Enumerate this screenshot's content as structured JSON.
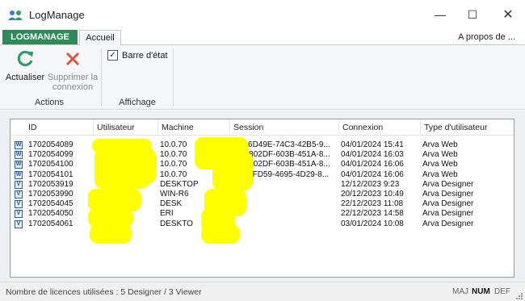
{
  "window": {
    "title": "LogManage",
    "minimize_glyph": "—",
    "maximize_glyph": "☐",
    "close_glyph": "✕",
    "icon": "users-icon"
  },
  "ribbon_tabs": {
    "app_tab": "LOGMANAGE",
    "home_tab": "Accueil",
    "about": "A propos de ..."
  },
  "ribbon": {
    "actions": {
      "label": "Actions",
      "refresh_label": "Actualiser",
      "delete_label_line1": "Supprimer la",
      "delete_label_line2": "connexion",
      "refresh_icon": "refresh-icon",
      "delete_icon": "delete-x-icon"
    },
    "display": {
      "label": "Affichage",
      "statusbar_checkbox": "Barre d'état",
      "statusbar_checked": true
    }
  },
  "table": {
    "columns": [
      "ID",
      "Utilisateur",
      "Machine",
      "Session",
      "Connexion",
      "Type d'utilisateur"
    ],
    "rows": [
      {
        "id": "1702054089",
        "user": "",
        "machine": "10.0.70",
        "session": "{7886D49E-74C3-42B5-9...",
        "connexion": "04/01/2024 15:41",
        "type": "Arva Web",
        "icon": "W"
      },
      {
        "id": "1702054099",
        "user": "",
        "machine": "10.0.70",
        "session": "{B91802DF-603B-451A-8...",
        "connexion": "04/01/2024 16:03",
        "type": "Arva Web",
        "icon": "W"
      },
      {
        "id": "1702054100",
        "user": "",
        "machine": "10.0.70",
        "session": "{B91802DF-603B-451A-8...",
        "connexion": "04/01/2024 16:06",
        "type": "Arva Web",
        "icon": "W"
      },
      {
        "id": "1702054101",
        "user": "",
        "machine": "10.0.70",
        "session": "{0403FD59-4695-4D29-8...",
        "connexion": "04/01/2024 16:06",
        "type": "Arva Web",
        "icon": "W"
      },
      {
        "id": "1702053919",
        "user": "",
        "machine": "DESKTOP",
        "session": "",
        "connexion": "12/12/2023 9:23",
        "type": "Arva Designer",
        "icon": "V"
      },
      {
        "id": "1702053990",
        "user": "",
        "machine": "WIN-R6",
        "session": "",
        "connexion": "20/12/2023 10:49",
        "type": "Arva Designer",
        "icon": "V"
      },
      {
        "id": "1702054045",
        "user": "",
        "machine": "DESK",
        "session": "",
        "connexion": "22/12/2023 11:08",
        "type": "Arva Designer",
        "icon": "V"
      },
      {
        "id": "1702054050",
        "user": "",
        "machine": "ERI",
        "session": "",
        "connexion": "22/12/2023 14:58",
        "type": "Arva Designer",
        "icon": "V"
      },
      {
        "id": "1702054061",
        "user": "",
        "machine": "DESKTO",
        "session": "",
        "connexion": "03/01/2024 10:08",
        "type": "Arva Designer",
        "icon": "V"
      }
    ]
  },
  "statusbar": {
    "licences": "Nombre de licences utilisées : 5 Designer / 3 Viewer",
    "caps": "MAJ",
    "num": "NUM",
    "scroll": "DEF"
  },
  "colors": {
    "app_tab": "#2e8b57",
    "refresh_icon": "#2e9d6a",
    "delete_icon": "#e0553f",
    "redaction": "#ffff00",
    "row_icon": "#2b5fa6"
  }
}
